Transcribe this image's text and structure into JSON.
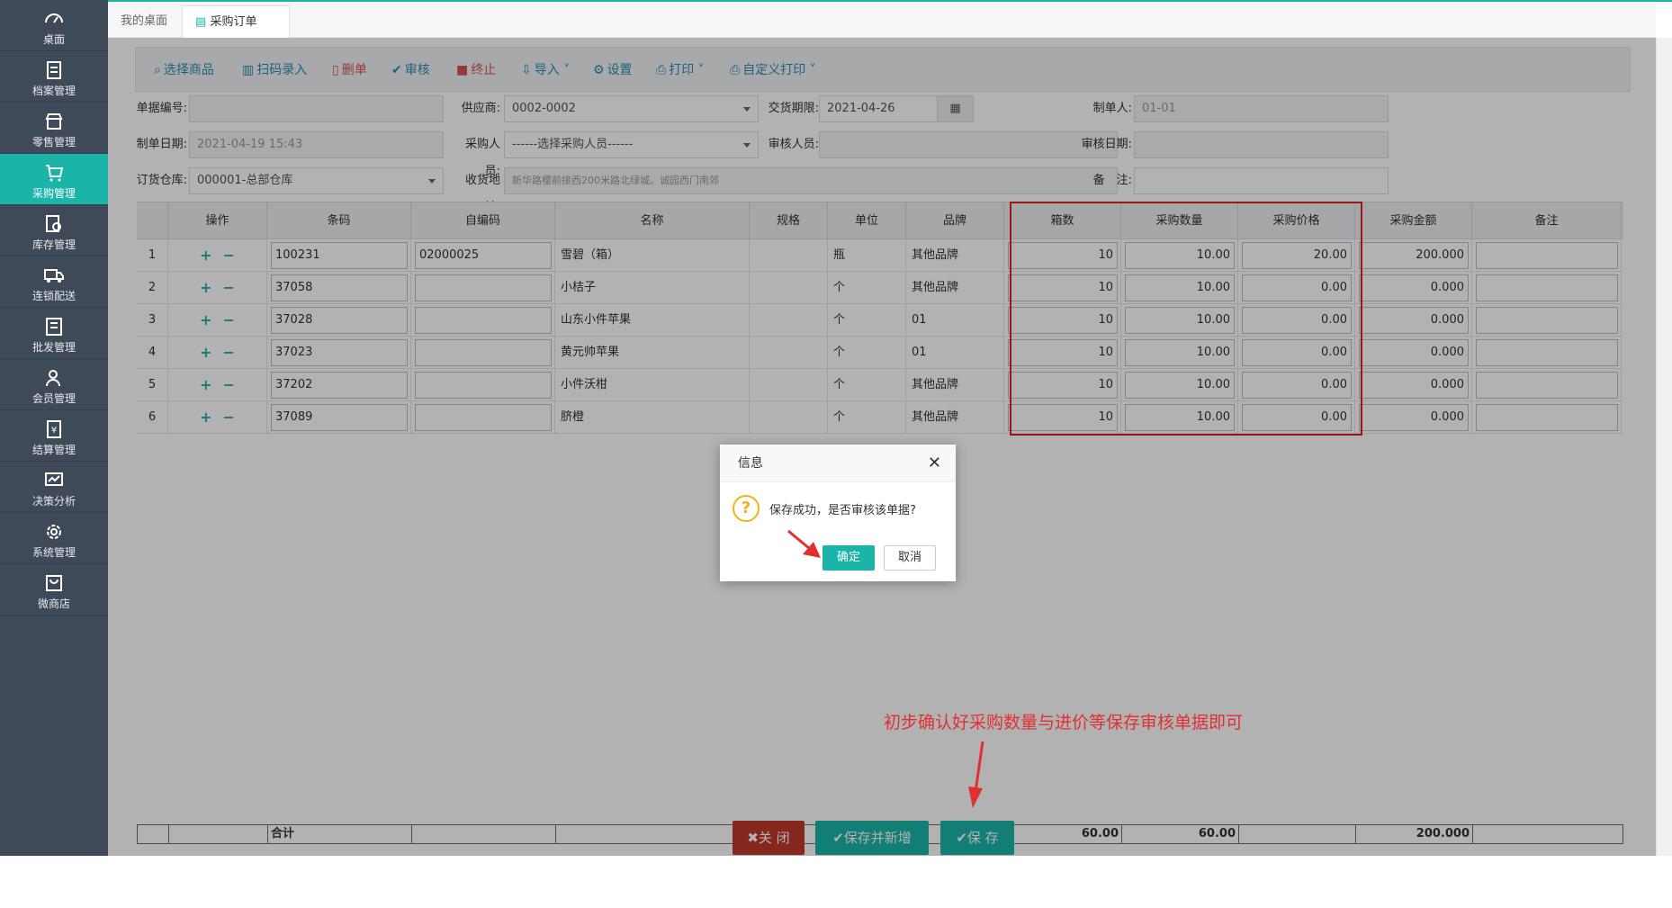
{
  "sidebar": {
    "items": [
      {
        "label": "桌面",
        "icon": "dashboard-icon"
      },
      {
        "label": "档案管理",
        "icon": "archive-icon"
      },
      {
        "label": "零售管理",
        "icon": "store-icon"
      },
      {
        "label": "采购管理",
        "icon": "cart-icon"
      },
      {
        "label": "库存管理",
        "icon": "inventory-icon"
      },
      {
        "label": "连锁配送",
        "icon": "truck-icon"
      },
      {
        "label": "批发管理",
        "icon": "wholesale-icon"
      },
      {
        "label": "会员管理",
        "icon": "member-icon"
      },
      {
        "label": "结算管理",
        "icon": "settlement-icon"
      },
      {
        "label": "决策分析",
        "icon": "analysis-icon"
      },
      {
        "label": "系统管理",
        "icon": "gear-icon"
      },
      {
        "label": "微商店",
        "icon": "shop-bag-icon"
      }
    ],
    "active_index": 3
  },
  "tabs": [
    {
      "label": "我的桌面"
    },
    {
      "label": "采购订单"
    }
  ],
  "toolbar": {
    "select_goods": "选择商品",
    "scan_entry": "扫码录入",
    "delete": "删单",
    "audit": "审核",
    "terminate": "终止",
    "import": "导入",
    "settings": "设置",
    "print": "打印",
    "custom_print": "自定义打印"
  },
  "form": {
    "doc_no_label": "单据编号:",
    "doc_no_value": "",
    "supplier_label": "供应商:",
    "supplier_value": "0002-0002",
    "delivery_label": "交货期限:",
    "delivery_value": "2021-04-26",
    "maker_label": "制单人:",
    "maker_value": "01-01",
    "date_label": "制单日期:",
    "date_value": "2021-04-19 15:43",
    "buyer_label": "采购人员:",
    "buyer_value": "------选择采购人员------",
    "auditor_label": "审核人员:",
    "auditor_value": "",
    "audit_date_label": "审核日期:",
    "audit_date_value": "",
    "warehouse_label": "订货仓库:",
    "warehouse_value": "000001-总部仓库",
    "address_label": "收货地址:",
    "address_value": "新华路樱前接西200米路北绿城。诚园西门南郊",
    "remark_label": "备　注:",
    "remark_value": ""
  },
  "grid": {
    "columns": [
      "操作",
      "条码",
      "自编码",
      "名称",
      "规格",
      "单位",
      "品牌",
      "箱数",
      "采购数量",
      "采购价格",
      "采购金额",
      "备注"
    ],
    "rows": [
      {
        "no": "1",
        "barcode": "100231",
        "code": "02000025",
        "name": "雪碧（箱）",
        "spec": "",
        "unit": "瓶",
        "brand": "其他品牌",
        "boxes": "10",
        "qty": "10.00",
        "price": "20.00",
        "amount": "200.000",
        "remark": ""
      },
      {
        "no": "2",
        "barcode": "37058",
        "code": "",
        "name": "小桔子",
        "spec": "",
        "unit": "个",
        "brand": "其他品牌",
        "boxes": "10",
        "qty": "10.00",
        "price": "0.00",
        "amount": "0.000",
        "remark": ""
      },
      {
        "no": "3",
        "barcode": "37028",
        "code": "",
        "name": "山东小件苹果",
        "spec": "",
        "unit": "个",
        "brand": "01",
        "boxes": "10",
        "qty": "10.00",
        "price": "0.00",
        "amount": "0.000",
        "remark": ""
      },
      {
        "no": "4",
        "barcode": "37023",
        "code": "",
        "name": "黄元帅苹果",
        "spec": "",
        "unit": "个",
        "brand": "01",
        "boxes": "10",
        "qty": "10.00",
        "price": "0.00",
        "amount": "0.000",
        "remark": ""
      },
      {
        "no": "5",
        "barcode": "37202",
        "code": "",
        "name": "小件沃柑",
        "spec": "",
        "unit": "个",
        "brand": "其他品牌",
        "boxes": "10",
        "qty": "10.00",
        "price": "0.00",
        "amount": "0.000",
        "remark": ""
      },
      {
        "no": "6",
        "barcode": "37089",
        "code": "",
        "name": "脐橙",
        "spec": "",
        "unit": "个",
        "brand": "其他品牌",
        "boxes": "10",
        "qty": "10.00",
        "price": "0.00",
        "amount": "0.000",
        "remark": ""
      }
    ],
    "footer": {
      "label": "合计",
      "boxes": "60.00",
      "qty": "60.00",
      "amount": "200.000"
    }
  },
  "buttons": {
    "close": "关 闭",
    "save_new": "保存并新增",
    "save": "保 存"
  },
  "annotation": "初步确认好采购数量与进价等保存审核单据即可",
  "dialog": {
    "title": "信息",
    "message": "保存成功，是否审核该单据?",
    "ok": "确定",
    "cancel": "取消"
  },
  "colors": {
    "accent": "#1ab5a8",
    "sidebar": "#3f4a58",
    "danger": "#c0392b",
    "highlight": "#e02020"
  }
}
